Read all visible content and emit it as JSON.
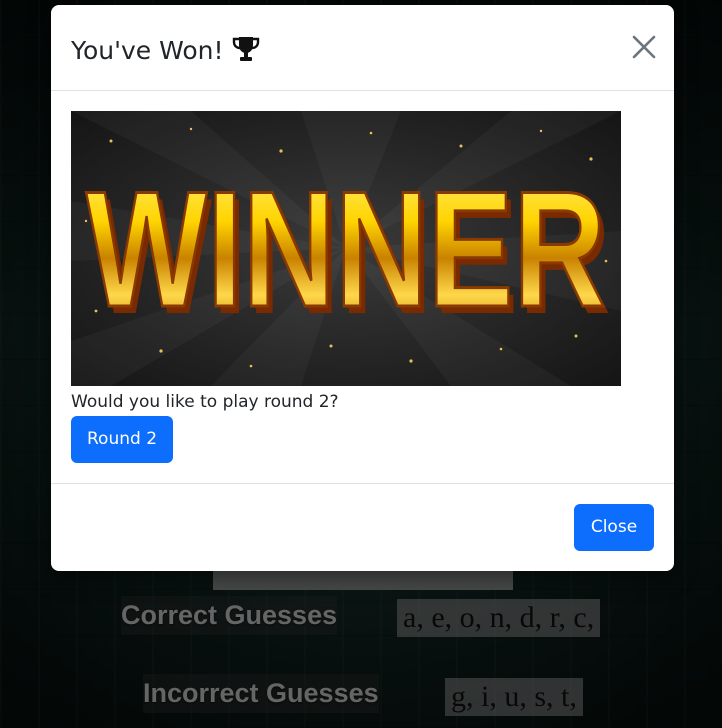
{
  "game": {
    "correct_label": "Correct Guesses",
    "correct_letters": "a, e, o, n, d, r, c,",
    "incorrect_label": "Incorrect Guesses",
    "incorrect_letters": "g, i, u, s, t,"
  },
  "modal": {
    "title": "You've Won!",
    "title_icon": "trophy-icon",
    "close_icon": "close-icon",
    "image_text": "WINNER",
    "prompt": "Would you like to play round 2?",
    "round_button": "Round 2",
    "close_button": "Close"
  },
  "colors": {
    "primary": "#0d6efd",
    "backdrop": "#1b3a35",
    "winner_gold": "#f2c200"
  }
}
